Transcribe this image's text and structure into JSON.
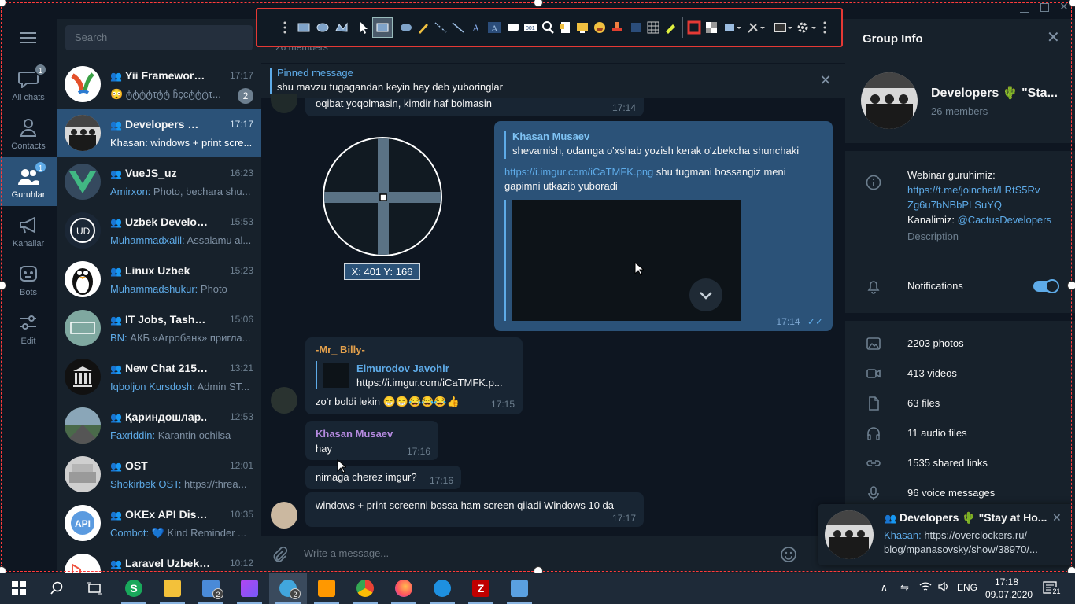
{
  "window": {
    "controls": [
      "minimize",
      "maximize",
      "close"
    ]
  },
  "rail": {
    "menu_icon": "hamburger-icon",
    "items": [
      {
        "label": "All chats",
        "icon": "chat-bubble-icon",
        "badge": "1"
      },
      {
        "label": "Contacts",
        "icon": "person-icon",
        "badge": ""
      },
      {
        "label": "Guruhlar",
        "icon": "group-icon",
        "badge": "1"
      },
      {
        "label": "Kanallar",
        "icon": "megaphone-icon",
        "badge": ""
      },
      {
        "label": "Bots",
        "icon": "bot-icon",
        "badge": ""
      },
      {
        "label": "Edit",
        "icon": "sliders-icon",
        "badge": ""
      }
    ]
  },
  "chatlist": {
    "search_placeholder": "Search",
    "chats": [
      {
        "name": "Yii Framework Uz...",
        "time": "17:17",
        "who": "",
        "preview": "😳 ტტტტτტტ ჩçcტტტτ...",
        "unread": "2",
        "avatar_color": "#ffffff"
      },
      {
        "name": "Developers 🌵 \"S...",
        "time": "17:17",
        "who": "",
        "preview": "Khasan: windows + print scre...",
        "unread": "",
        "avatar_color": "#3a3a3a"
      },
      {
        "name": "VueJS_uz",
        "time": "16:23",
        "who": "Amirxon:",
        "preview": " Photo, bechara shu...",
        "unread": "",
        "avatar_color": "#35495e"
      },
      {
        "name": "Uzbek Developers",
        "time": "15:53",
        "who": "Muhammadxalil:",
        "preview": " Assalamu al...",
        "unread": "",
        "avatar_color": "#1b2736"
      },
      {
        "name": "Linux Uzbek",
        "time": "15:23",
        "who": "Muhammadshukur:",
        "preview": " Photo",
        "unread": "",
        "avatar_color": "#ffffff"
      },
      {
        "name": "IT Jobs, Tashkent",
        "time": "15:06",
        "who": "BN:",
        "preview": " АКБ «Агробанк» пригла...",
        "unread": "",
        "avatar_color": "#7fa8a0"
      },
      {
        "name": "New Chat 215~17",
        "time": "13:21",
        "who": "Iqboljon Kursdosh:",
        "preview": " Admin ST...",
        "unread": "",
        "avatar_color": "#111111"
      },
      {
        "name": "Қариндошлар..",
        "time": "12:53",
        "who": "Faxriddin:",
        "preview": " Karantin ochilsa",
        "unread": "",
        "avatar_color": "#4a6a4a"
      },
      {
        "name": "OST",
        "time": "12:01",
        "who": "Shokirbek OST:",
        "preview": " https://threa...",
        "unread": "",
        "avatar_color": "#cfcfcf"
      },
      {
        "name": "OKEx API Discussi...",
        "time": "10:35",
        "who": "Combot:",
        "preview": " 💙 Kind Reminder ...",
        "unread": "",
        "avatar_color": "#5b9be0"
      },
      {
        "name": "Laravel Uzbek Co...",
        "time": "10:12",
        "who": "",
        "preview": "",
        "unread": "",
        "avatar_color": "#ffffff"
      }
    ]
  },
  "header": {
    "members": "26 members"
  },
  "pinned": {
    "title": "Pinned message",
    "text": "shu mavzu tugagandan keyin hay deb yuboringlar"
  },
  "magnifier": {
    "coords": "X: 401 Y: 166"
  },
  "messages": {
    "m1": {
      "text": "oqibat yoqolmasin, kimdir haf bolmasin",
      "time": "17:14"
    },
    "m2": {
      "reply_name": "Khasan Musaev",
      "reply_text": "shevamish, odamga o'xshab yozish kerak o'zbekcha shunchaki",
      "link": "https://i.imgur.com/iCaTMFK.png",
      "text": " shu tugmani bossangiz meni gapimni utkazib yuboradi",
      "time": "17:14"
    },
    "m3": {
      "sender": "-Mr_ Billy-",
      "reply_name": "Elmurodov Javohir",
      "reply_text": "https://i.imgur.com/iCaTMFK.p...",
      "text": "zo'r boldi lekin 😁😁😂😂😂👍",
      "time": "17:15"
    },
    "m4": {
      "sender": "Khasan Musaev",
      "text": "hay",
      "time": "17:16"
    },
    "m5": {
      "text": "nimaga cherez imgur?",
      "time": "17:16"
    },
    "m6": {
      "text": "windows + print screenni bossa ham screen qiladi Windows 10 da",
      "time": "17:17"
    }
  },
  "composer": {
    "placeholder": "Write a message..."
  },
  "info": {
    "title": "Group Info",
    "name": "Developers 🌵 \"Sta...",
    "members": "26 members",
    "desc_line1": "Webinar guruhimiz:",
    "desc_link": "https://t.me/joinchat/LRtS5Rv",
    "desc_link2": "Zg6u7bNBbPLSuYQ",
    "channel_prefix": "Kanalimiz: ",
    "channel_link": "@CactusDevelopers",
    "desc_label": "Description",
    "notifications": "Notifications",
    "stats": [
      {
        "label": "2203 photos",
        "icon": "photo-icon"
      },
      {
        "label": "413 videos",
        "icon": "video-icon"
      },
      {
        "label": "63 files",
        "icon": "file-icon"
      },
      {
        "label": "11 audio files",
        "icon": "headphones-icon"
      },
      {
        "label": "1535 shared links",
        "icon": "link-icon"
      },
      {
        "label": "96 voice messages",
        "icon": "microphone-icon"
      }
    ]
  },
  "toast": {
    "title": "Developers 🌵 \"Stay at Ho...",
    "sender": "Khasan:",
    "line1": " https://overclockers.ru/",
    "line2": "blog/mpanasovsky/show/38970/..."
  },
  "taskbar": {
    "apps": [
      "start",
      "search",
      "task-view",
      "skype",
      "file-explorer",
      "mail",
      "phpstorm",
      "telegram",
      "sublime-text",
      "chrome",
      "firefox",
      "edge",
      "filezilla",
      "control-panel"
    ],
    "mail_badge": "2",
    "telegram_badge": "2",
    "lang": "ENG",
    "time": "17:18",
    "date": "09.07.2020",
    "notif_count": "21",
    "accent": "#5eabe8"
  }
}
